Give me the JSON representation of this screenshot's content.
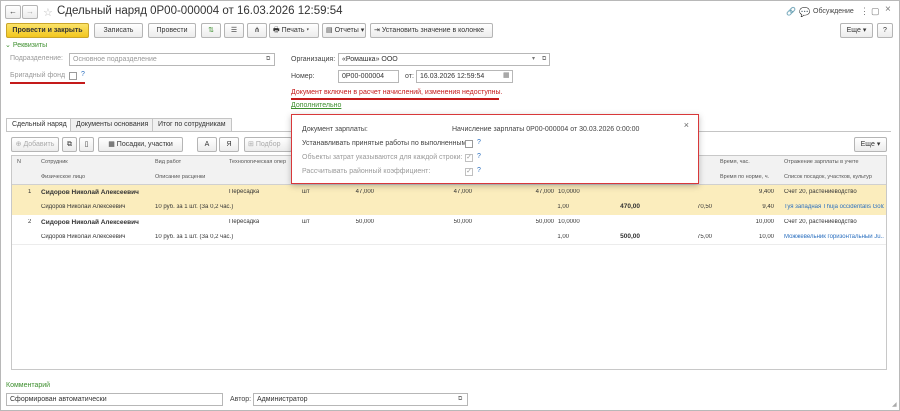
{
  "window": {
    "title": "Сдельный наряд 0Р00-000004 от 16.03.2026 12:59:54",
    "discussion": "Обсуждение"
  },
  "toolbar": {
    "post_close": "Провести и закрыть",
    "save": "Записать",
    "post": "Провести",
    "print": "Печать",
    "reports": "Отчеты",
    "set_value": "Установить значение в колонке",
    "more": "Еще",
    "help": "?"
  },
  "requisites": {
    "title": "Реквизиты",
    "department_label": "Подразделение:",
    "department_value": "Основное подразделение",
    "brigade_fund_label": "Бригадный фонд",
    "org_label": "Организация:",
    "org_value": "«Ромашка» ООО",
    "number_label": "Номер:",
    "number_value": "0Р00-000004",
    "date_label": "от:",
    "date_value": "16.03.2026 12:59:54",
    "locked_msg": "Документ включен в расчет начислений, изменения недоступны.",
    "additional": "Дополнительно"
  },
  "tabs": [
    {
      "label": "Сдельный наряд"
    },
    {
      "label": "Документы основания"
    },
    {
      "label": "Итог по сотрудникам"
    }
  ],
  "table_toolbar": {
    "add": "Добавить",
    "plots": "Посадки, участки",
    "pick": "Подбор",
    "more": "Еще"
  },
  "table": {
    "headers": {
      "n": "N",
      "employee": "Сотрудник",
      "person": "Физическое лицо",
      "work_type": "Вид работ",
      "rate_desc": "Описание расценки",
      "tech_op": "Технологическая опер",
      "time": "Время, час.",
      "time_norm": "Время по норме, ч.",
      "salary": "Отражение зарплаты в учете",
      "plants": "Список посадок, участков, культур"
    },
    "rows": [
      {
        "n": "1",
        "employee": "Сидоров Николай Алексеевич",
        "person": "Сидоров Николай Алексеевич",
        "rate_desc": "10 руб. за 1 шт. (За 0,2 час.)",
        "tech_op": "Пересадка",
        "unit": "шт",
        "qty1": "47,000",
        "qty2": "47,000",
        "qty3": "47,000",
        "coef": "1,00",
        "rate": "10,0000",
        "sum": "470,00",
        "norm": "70,50",
        "time": "9,400",
        "time_norm": "9,40",
        "salary": "Счет 20, растениеводство",
        "plants": "Туя западная Thuja occidentalis Gold..."
      },
      {
        "n": "2",
        "employee": "Сидоров Николай Алексеевич",
        "person": "Сидоров Николай Алексеевич",
        "rate_desc": "10 руб. за 1 шт. (За 0,2 час.)",
        "tech_op": "Пересадка",
        "unit": "шт",
        "qty1": "50,000",
        "qty2": "50,000",
        "qty3": "50,000",
        "coef": "1,00",
        "rate": "10,0000",
        "sum": "500,00",
        "norm": "75,00",
        "time": "10,000",
        "time_norm": "10,00",
        "salary": "Счет 20, растениеводство",
        "plants": "Можжевельник горизонтальный Ju..."
      }
    ]
  },
  "popup": {
    "doc_label": "Документ зарплаты:",
    "doc_value": "Начисление зарплаты 0Р00-000004 от 30.03.2026 0:00:00",
    "done_label": "Устанавливать принятые работы по выполненным:",
    "cost_label": "Объекты затрат указываются для каждой строки:",
    "district_label": "Рассчитывать районный коэффициент:"
  },
  "footer": {
    "comment_label": "Комментарий",
    "comment_value": "Сформирован автоматически",
    "author_label": "Автор:",
    "author_value": "Администратор"
  },
  "colors": {
    "accent_yellow": "#f2c61e",
    "selected_row": "#fbedbd",
    "green": "#3d8f2e",
    "red": "#c41a1a"
  }
}
